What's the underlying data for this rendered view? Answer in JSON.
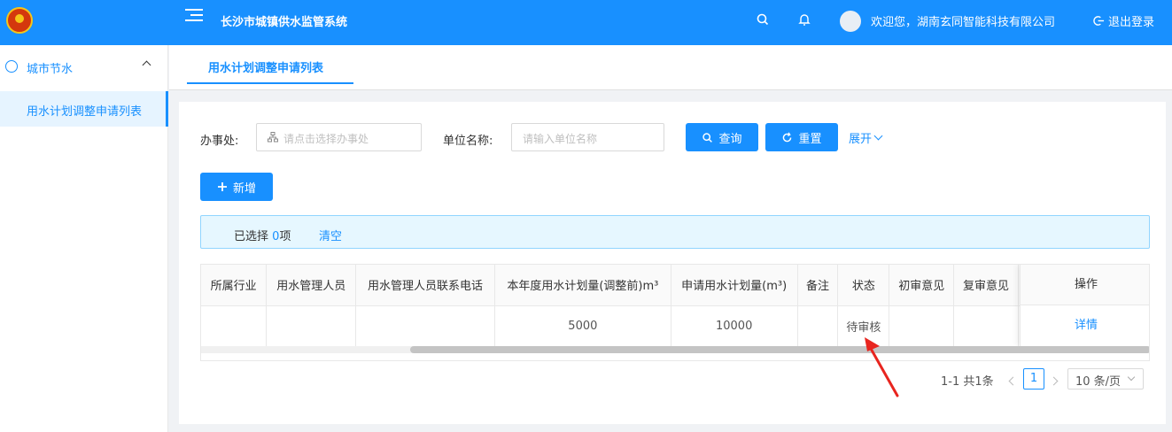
{
  "header": {
    "system_title": "长沙市城镇供水监管系统",
    "welcome": "欢迎您，湖南玄同智能科技有限公司",
    "logout": "退出登录"
  },
  "sidebar": {
    "group_label": "城市节水",
    "items": [
      {
        "label": "用水计划调整申请列表"
      }
    ]
  },
  "tabs": [
    {
      "label": "用水计划调整申请列表"
    }
  ],
  "search": {
    "office_label": "办事处:",
    "office_placeholder": "请点击选择办事处",
    "unit_label": "单位名称:",
    "unit_placeholder": "请输入单位名称",
    "query_button": "查询",
    "reset_button": "重置",
    "expand_link": "展开"
  },
  "toolbar": {
    "add_button": "新增"
  },
  "selection": {
    "prefix": "已选择",
    "count": "0",
    "suffix": "项",
    "clear": "清空"
  },
  "table": {
    "columns": [
      "所属行业",
      "用水管理人员",
      "用水管理人员联系电话",
      "本年度用水计划量(调整前)m³",
      "申请用水计划量(m³)",
      "备注",
      "状态",
      "初审意见",
      "复审意见",
      "操作"
    ],
    "rows": [
      {
        "industry": "",
        "manager": "",
        "phone": "",
        "plan_before": "5000",
        "plan_applied": "10000",
        "remark": "",
        "status": "待审核",
        "first_review": "",
        "second_review": "",
        "action": "详情"
      }
    ]
  },
  "pagination": {
    "total": "1-1 共1条",
    "current": "1",
    "page_size": "10 条/页"
  },
  "colors": {
    "primary": "#1890ff",
    "annotation_arrow": "#e8251f"
  }
}
